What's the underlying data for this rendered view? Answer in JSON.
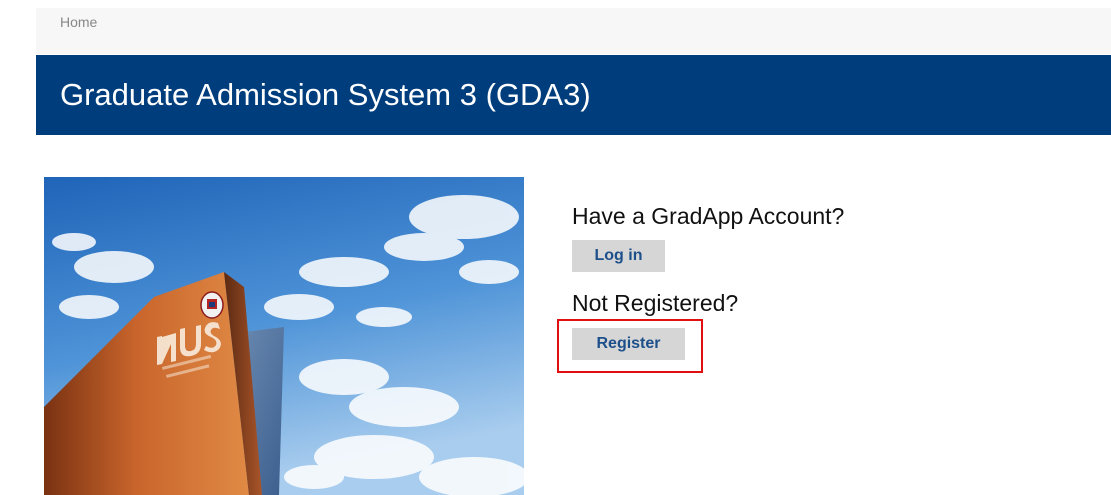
{
  "breadcrumb": {
    "home_label": "Home"
  },
  "header": {
    "title": "Graduate Admission System 3 (GDA3)"
  },
  "hero": {
    "image_name": "nus-campus-photo"
  },
  "account": {
    "heading": "Have a GradApp Account?",
    "login_label": "Log in"
  },
  "registration": {
    "heading": "Not Registered?",
    "register_label": "Register"
  },
  "colors": {
    "header_bg": "#003d7c",
    "button_bg": "#d6d6d6",
    "button_text": "#1d4f8a",
    "highlight": "#e01010"
  }
}
